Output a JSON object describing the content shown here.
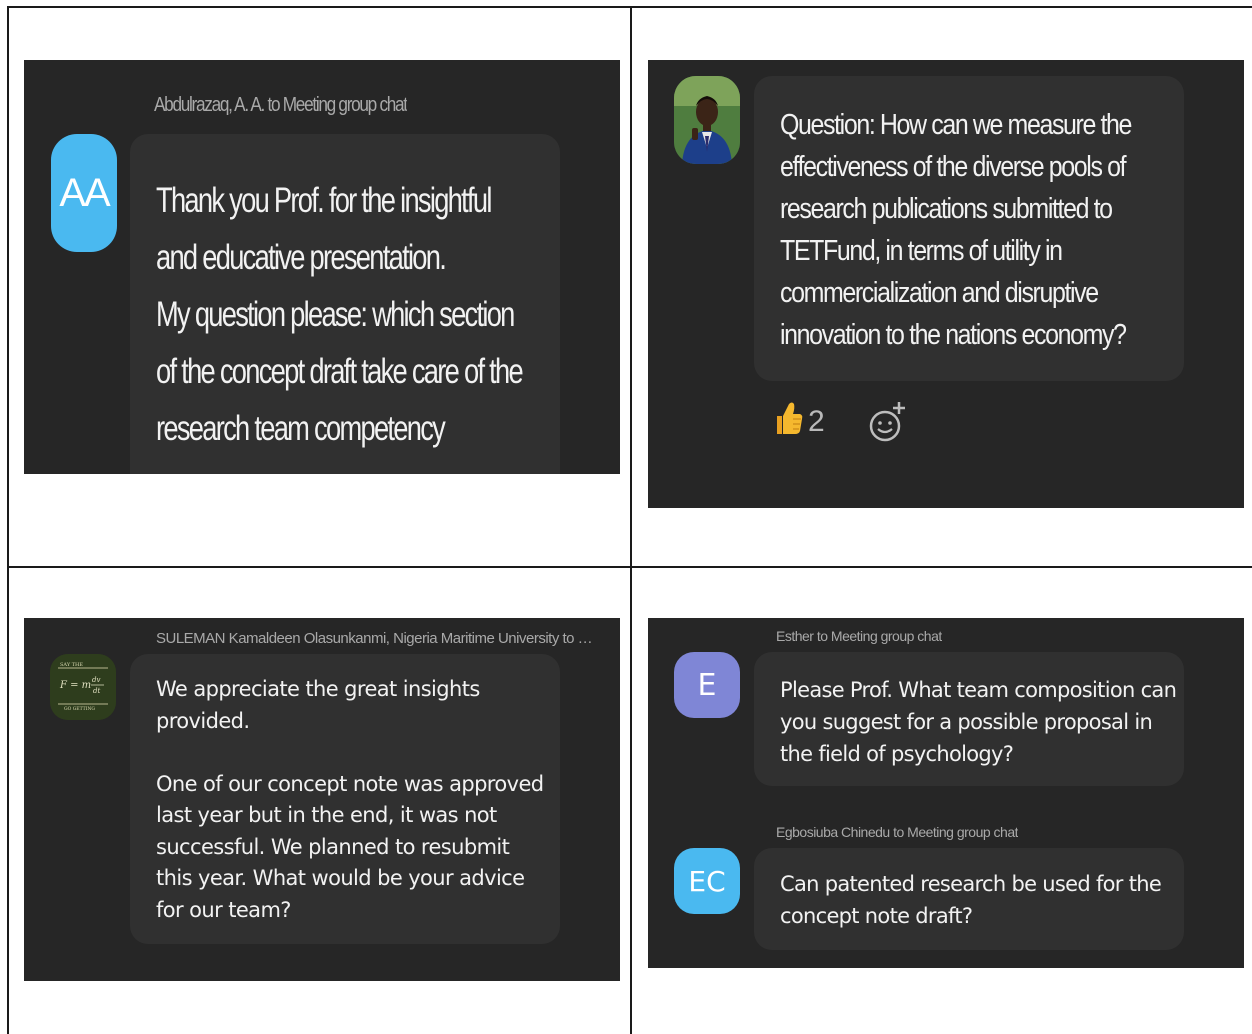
{
  "panels": [
    {
      "sender": "Abdulrazaq, A. A. to Meeting group chat",
      "avatar_initials": "AA",
      "message": "Thank you Prof.  for the insightful and educative presentation.\nMy question please: which section of the concept draft take care of the research team competency",
      "avatar_color": "#4ab9f0"
    },
    {
      "avatar_icon": "profile-photo-icon",
      "message": "Question: How can we measure the effectiveness of the diverse pools of research publications submitted to TETFund, in terms of utility in commercialization and disruptive innovation to the nations economy?",
      "reaction": {
        "emoji_icon": "thumbs-up-icon",
        "count": "2"
      },
      "add_reaction_icon": "add-reaction-icon"
    },
    {
      "sender": "SULEMAN Kamaldeen Olasunkanmi, Nigeria Maritime University to M...",
      "avatar_icon": "equation-avatar-icon",
      "message": "We appreciate the great insights provided.\n\nOne of our concept note was approved last year but in the end, it was not successful. We planned to resubmit this year. What would be your advice for our team?"
    },
    {
      "messages": [
        {
          "sender": "Esther to Meeting group chat",
          "avatar_initials": "E",
          "avatar_color": "#7f86d6",
          "message": "Please Prof. What team composition can you suggest for a possible proposal in the field of psychology?"
        },
        {
          "sender": "Egbosiuba Chinedu to Meeting group chat",
          "avatar_initials": "EC",
          "avatar_color": "#4ab9f0",
          "message": "Can patented research be used for the concept note draft?"
        }
      ]
    }
  ],
  "colors": {
    "panel_bg": "#262626",
    "bubble_bg": "#303030",
    "text": "#f2f2f2",
    "sender_text": "#a9a9a9"
  }
}
